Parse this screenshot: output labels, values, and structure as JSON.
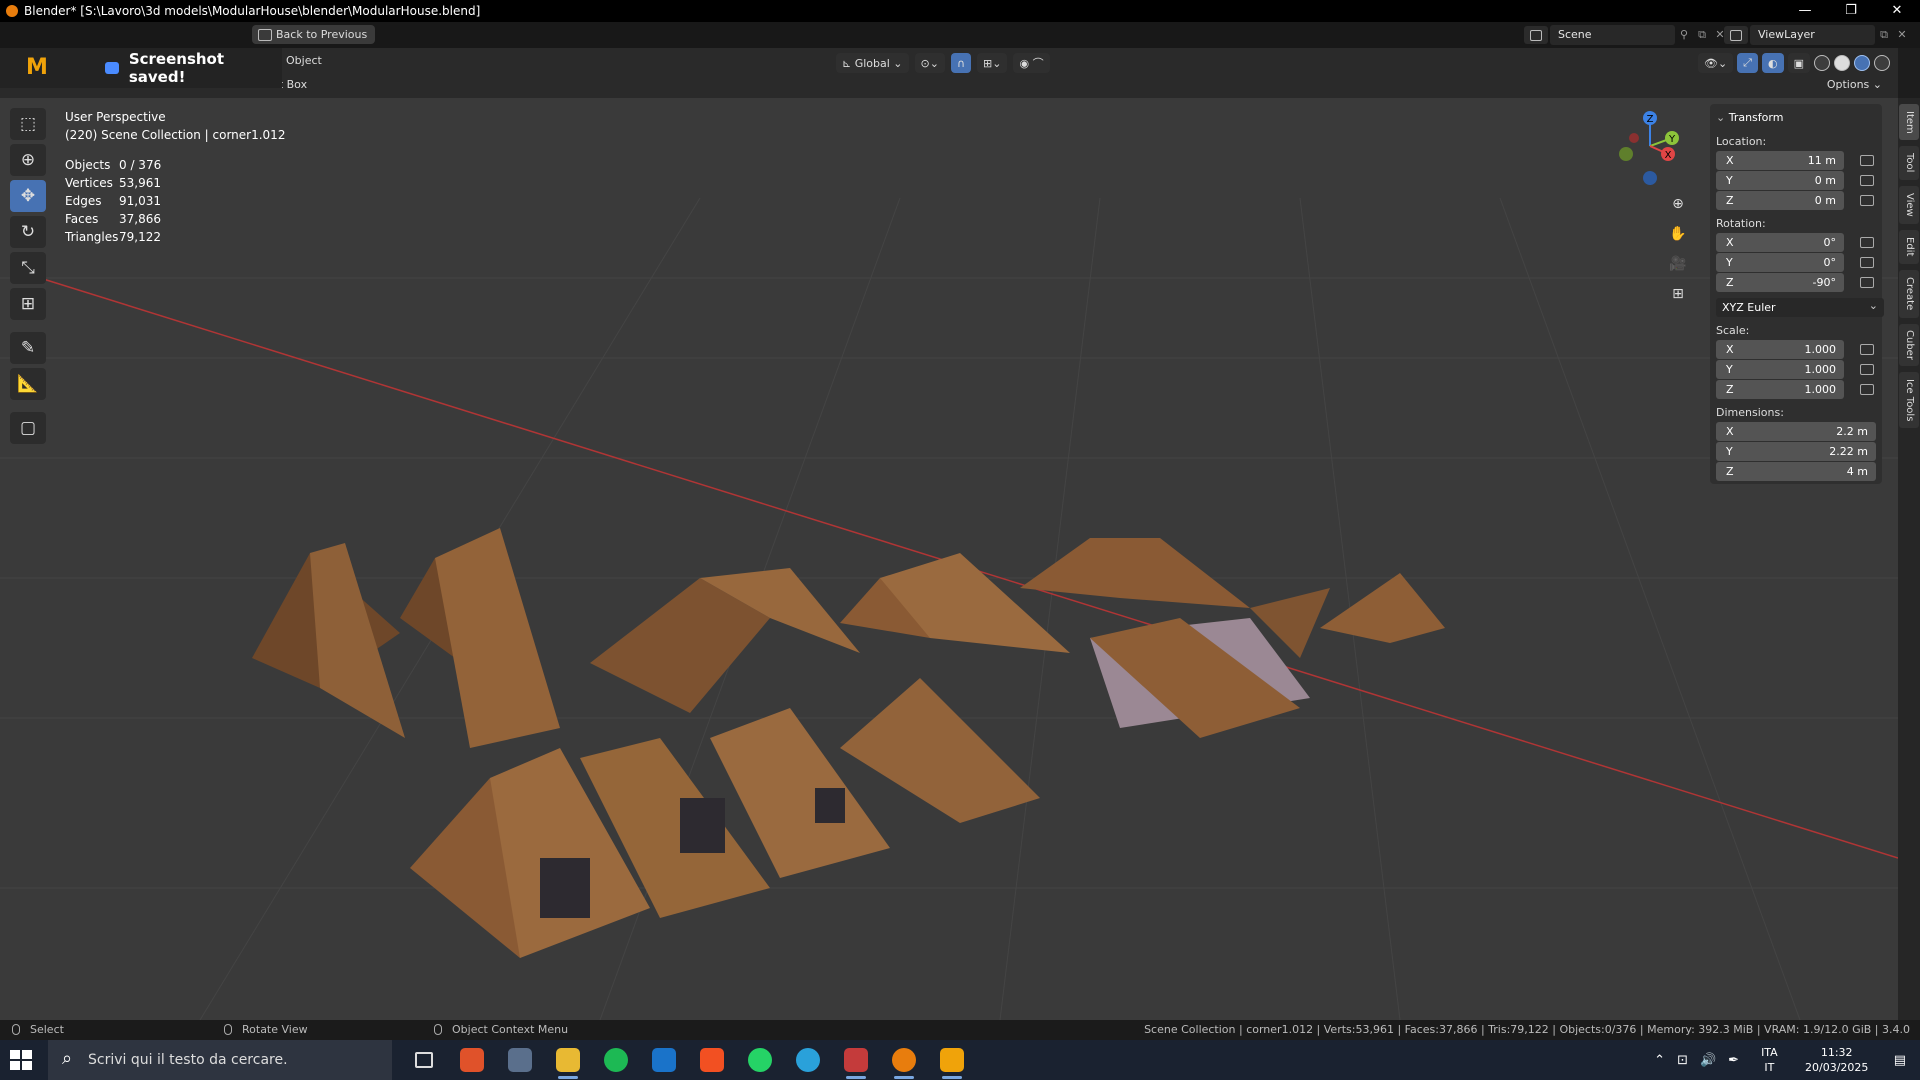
{
  "window": {
    "title": "Blender* [S:\\Lavoro\\3d models\\ModularHouse\\blender\\ModularHouse.blend]",
    "controls": [
      "—",
      "❐",
      "✕"
    ]
  },
  "topbar": {
    "back_label": "Back to Previous",
    "scene": "Scene",
    "view_layer": "ViewLayer"
  },
  "notification": {
    "logo": "M",
    "message": "Screenshot saved!"
  },
  "header": {
    "object_menu": "Object",
    "select_box": "ect Box",
    "orientation": "Global",
    "options": "Options"
  },
  "stats": {
    "perspective": "User Perspective",
    "collection": "(220) Scene Collection | corner1.012",
    "rows": [
      {
        "k": "Objects",
        "v": "0 / 376"
      },
      {
        "k": "Vertices",
        "v": "53,961"
      },
      {
        "k": "Edges",
        "v": "91,031"
      },
      {
        "k": "Faces",
        "v": "37,866"
      },
      {
        "k": "Triangles",
        "v": "79,122"
      }
    ]
  },
  "gizmo": {
    "z": "Z",
    "y": "Y",
    "x": "X"
  },
  "transform": {
    "title": "Transform",
    "location_label": "Location:",
    "location": [
      {
        "a": "X",
        "v": "11 m"
      },
      {
        "a": "Y",
        "v": "0 m"
      },
      {
        "a": "Z",
        "v": "0 m"
      }
    ],
    "rotation_label": "Rotation:",
    "rotation": [
      {
        "a": "X",
        "v": "0°"
      },
      {
        "a": "Y",
        "v": "0°"
      },
      {
        "a": "Z",
        "v": "-90°"
      }
    ],
    "rotation_mode": "XYZ Euler",
    "scale_label": "Scale:",
    "scale": [
      {
        "a": "X",
        "v": "1.000"
      },
      {
        "a": "Y",
        "v": "1.000"
      },
      {
        "a": "Z",
        "v": "1.000"
      }
    ],
    "dimensions_label": "Dimensions:",
    "dimensions": [
      {
        "a": "X",
        "v": "2.2 m"
      },
      {
        "a": "Y",
        "v": "2.22 m"
      },
      {
        "a": "Z",
        "v": "4 m"
      }
    ]
  },
  "sidetabs": [
    "Item",
    "Tool",
    "View",
    "Edit",
    "Create",
    "Cuber",
    "Ice Tools"
  ],
  "statusbar": {
    "select": "Select",
    "rotate": "Rotate View",
    "context": "Object Context Menu",
    "info": "Scene Collection | corner1.012 | Verts:53,961 | Faces:37,866 | Tris:79,122 | Objects:0/376 | Memory: 392.3 MiB | VRAM: 1.9/12.0 GiB | 3.4.0"
  },
  "taskbar": {
    "search_placeholder": "Scrivi qui il testo da cercare.",
    "lang_top": "ITA",
    "lang_bottom": "IT",
    "time": "11:32",
    "date": "20/03/2025"
  },
  "colors": {
    "accent": "#4772b3",
    "axis_x": "#e04545",
    "axis_y": "#8cc43a",
    "axis_z": "#3c82e6",
    "roof": "#8a5a34"
  }
}
